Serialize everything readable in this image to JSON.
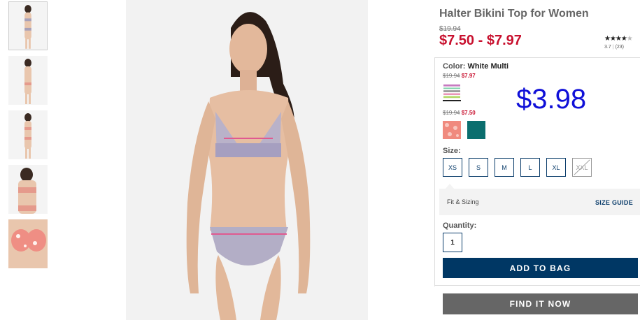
{
  "product": {
    "title": "Halter Bikini Top for Women",
    "original_price": "$19.94",
    "sale_price": "$7.50 - $7.97",
    "rating": {
      "stars_filled": 4,
      "stars_total": 5,
      "score": "3.7",
      "count": "(23)"
    }
  },
  "color": {
    "label": "Color:",
    "selected": "White Multi",
    "groups": [
      {
        "original": "$19.94",
        "sale": "$7.97",
        "swatches": [
          {
            "name": "white-multi",
            "selected": true
          }
        ]
      },
      {
        "original": "$19.94",
        "sale": "$7.50",
        "swatches": [
          {
            "name": "coral-floral",
            "color": "#f08a7e"
          },
          {
            "name": "teal",
            "color": "#0b6e6e"
          }
        ]
      }
    ]
  },
  "overlay_price": "$3.98",
  "size": {
    "label": "Size:",
    "options": [
      {
        "label": "XS",
        "available": true
      },
      {
        "label": "S",
        "available": true
      },
      {
        "label": "M",
        "available": true
      },
      {
        "label": "L",
        "available": true
      },
      {
        "label": "XL",
        "available": true
      },
      {
        "label": "XXL",
        "available": false
      }
    ]
  },
  "fit": {
    "label": "Fit & Sizing",
    "size_guide": "SIZE GUIDE"
  },
  "quantity": {
    "label": "Quantity:",
    "value": "1"
  },
  "buttons": {
    "add_to_bag": "ADD TO BAG",
    "find_it_now": "FIND IT NOW"
  },
  "colors": {
    "sale_red": "#c8102e",
    "navy": "#003764",
    "gray_button": "#666666",
    "overlay_blue": "#1010d8"
  }
}
